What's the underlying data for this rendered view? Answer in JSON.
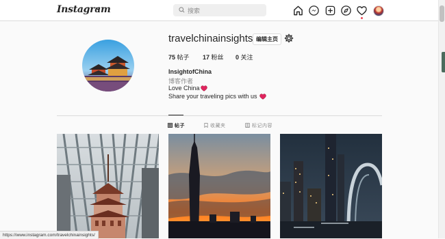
{
  "nav": {
    "logo": "Instagram",
    "search_placeholder": "搜索",
    "icons": [
      "home-icon",
      "messenger-icon",
      "new-post-icon",
      "explore-icon",
      "activity-heart-icon",
      "profile-avatar"
    ]
  },
  "profile": {
    "username": "travelchinainsights",
    "edit_label": "编辑主页",
    "stats": {
      "posts_count": "75",
      "posts_label": "帖子",
      "followers_count": "17",
      "followers_label": "粉丝",
      "following_count": "0",
      "following_label": "关注"
    },
    "full_name": "InsightofChina",
    "category": "博客作者",
    "bio_line1": "Love China",
    "bio_line2": "Share your traveling pics with us"
  },
  "tabs": [
    {
      "label": "帖子",
      "active": true
    },
    {
      "label": "收藏夹",
      "active": false
    },
    {
      "label": "标记内容",
      "active": false
    }
  ],
  "posts": [
    "canton-tower-pagoda",
    "tower-sunset",
    "night-skyline"
  ],
  "status_url": "https://www.instagram.com/travelchinainsights/",
  "colors": {
    "accent_red": "#ed4956",
    "border": "#dbdbdb",
    "muted": "#8e8e8e"
  }
}
